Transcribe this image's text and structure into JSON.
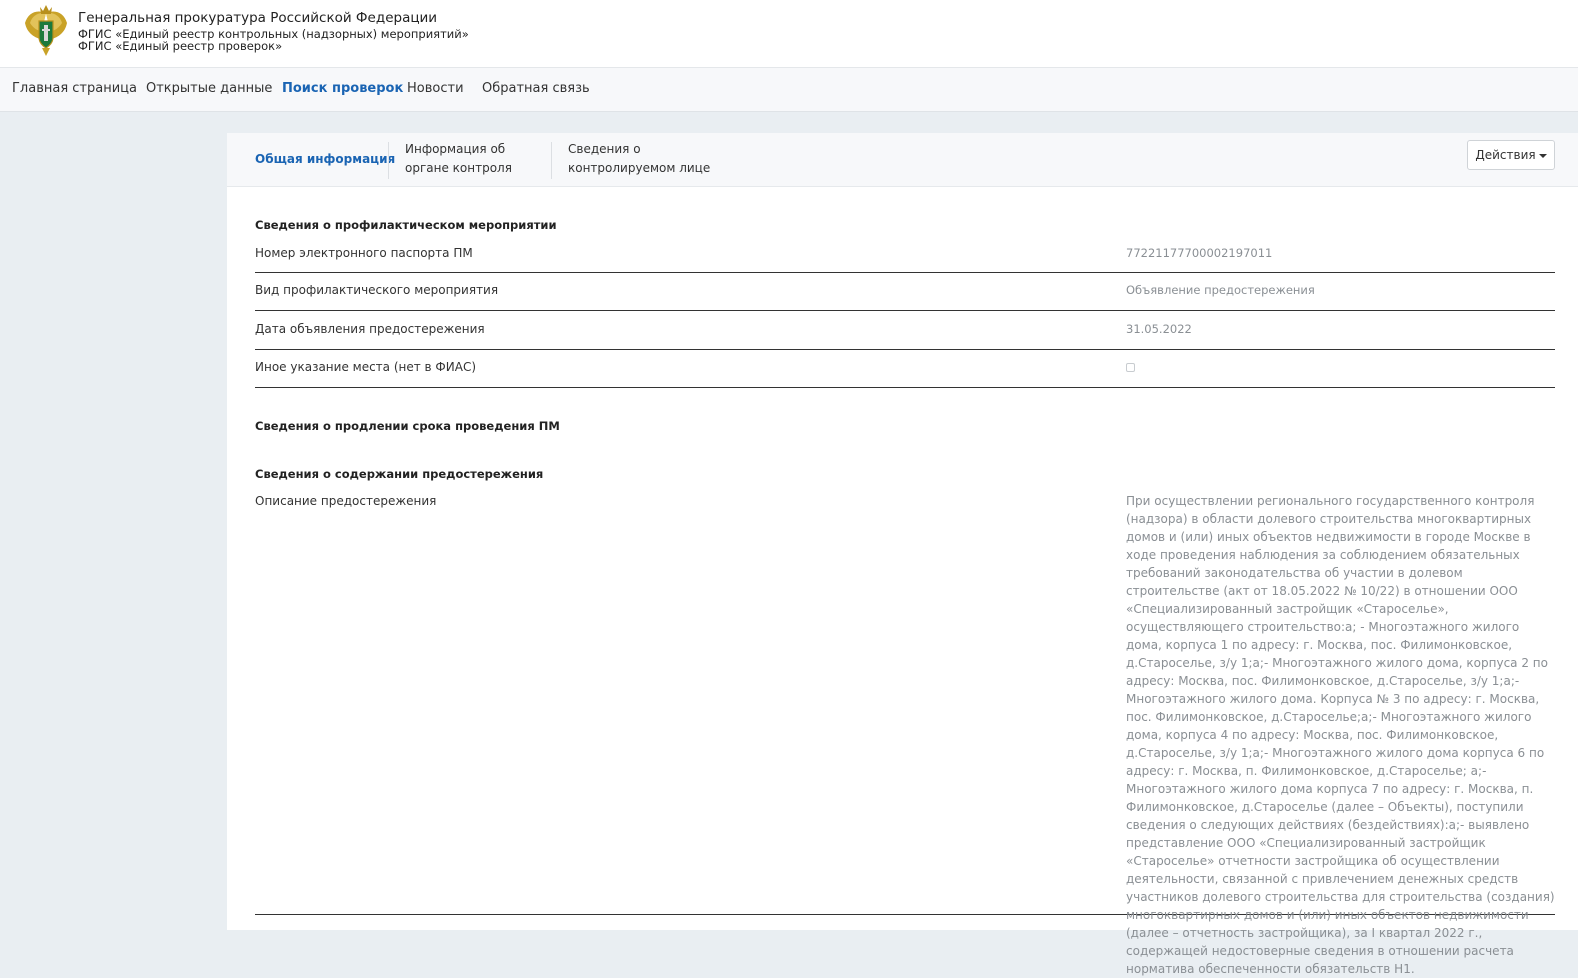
{
  "header": {
    "org": "Генеральная прокуратура Российской Федерации",
    "system1": "ФГИС «Единый реестр контрольных (надзорных) мероприятий»",
    "system2": "ФГИС «Единый реестр проверок»",
    "logo_icon": "coat-of-arms-icon"
  },
  "nav": {
    "items": [
      {
        "label": "Главная страница"
      },
      {
        "label": "Открытые данные"
      },
      {
        "label": "Поиск проверок",
        "active": true
      },
      {
        "label": "Новости"
      },
      {
        "label": "Обратная связь"
      }
    ],
    "active_color": "#1a64b3"
  },
  "tabs": [
    {
      "label": "Общая информация",
      "active": true
    },
    {
      "label_line1": "Информация об",
      "label_line2": "органе контроля"
    },
    {
      "label_line1": "Сведения о",
      "label_line2": "контролируемом лице"
    }
  ],
  "actions_label": "Действия",
  "sections": {
    "prevention": {
      "title": "Сведения о профилактическом мероприятии",
      "rows": [
        {
          "label": "Номер электронного паспорта ПМ",
          "value": "77221177700002197011"
        },
        {
          "label": "Вид профилактического мероприятия",
          "value": "Объявление предостережения"
        },
        {
          "label": "Дата объявления предостережения",
          "value": "31.05.2022"
        },
        {
          "label": "Иное указание места (нет в ФИАС)",
          "checked": false
        }
      ]
    },
    "extension": {
      "title": "Сведения о продлении срока проведения ПМ"
    },
    "content": {
      "title": "Сведения о содержании предостережения",
      "desc_label": "Описание предостережения",
      "desc_value": "При осуществлении регионального государственного контроля (надзора) в области долевого строительства многоквартирных домов и (или) иных объектов недвижимости в городе Москве в ходе проведения наблюдения за соблюдением обязательных требований законодательства об участии в долевом строительстве (акт от 18.05.2022 № 10/22) в отношении ООО «Специализированный застройщик «Староселье», осуществляющего строительство:а; - Многоэтажного жилого дома, корпуса 1 по адресу: г. Москва, пос. Филимонковское, д.Староселье, з/у 1;а;- Многоэтажного жилого дома, корпуса 2 по адресу: Москва, пос. Филимонковское, д.Староселье, з/у 1;а;- Многоэтажного жилого дома. Корпуса № 3 по адресу: г. Москва, пос. Филимонковское, д.Староселье;а;- Многоэтажного жилого дома, корпуса 4 по адресу: Москва, пос. Филимонковское, д.Староселье, з/у 1;а;- Многоэтажного жилого дома корпуса 6 по адресу: г. Москва, п. Филимонковское, д.Староселье; а;- Многоэтажного жилого дома корпуса 7 по адресу: г. Москва, п. Филимонковское, д.Староселье (далее – Объекты), поступили сведения о следующих действиях (бездействиях):а;- выявлено представление ООО «Специализированный застройщик «Староселье» отчетности застройщика об осуществлении деятельности, связанной с привлечением денежных средств участников долевого строительства для строительства (создания) многоквартирных домов и (или) иных объектов недвижимости (далее – отчетность застройщика), за I квартал 2022 г., содержащей недостоверные сведения в отношении расчета норматива обеспеченности обязательств Н1."
    }
  }
}
